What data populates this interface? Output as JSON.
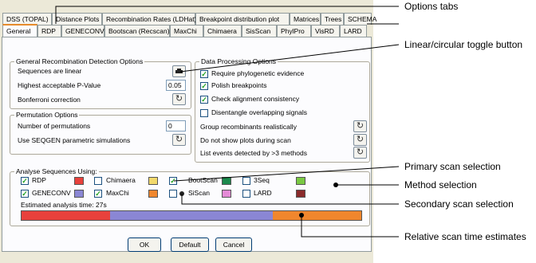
{
  "tabs_row1": [
    "DSS (TOPAL)",
    "Distance Plots",
    "Recombination Rates (LDHat)",
    "Breakpoint distribution plot",
    "Matrices",
    "Trees",
    "SCHEMA"
  ],
  "tabs_row2": [
    "General",
    "RDP",
    "GENECONV",
    "Bootscan (Recscan)",
    "MaxChi",
    "Chimaera",
    "SisScan",
    "PhylPro",
    "VisRD",
    "LARD"
  ],
  "active_tab": "General",
  "general_detection": {
    "title": "General Recombination Detection Options",
    "sequences_label": "Sequences are linear",
    "pvalue_label": "Highest acceptable P-Value",
    "pvalue": "0.05",
    "bonferroni_label": "Bonferroni correction"
  },
  "permutation": {
    "title": "Permutation Options",
    "num_label": "Number of permutations",
    "num_value": "0",
    "seqgen_label": "Use SEQGEN parametric simulations"
  },
  "data_processing": {
    "title": "Data Processing Options",
    "items": [
      {
        "label": "Require phylogenetic evidence",
        "checked": true
      },
      {
        "label": "Polish breakpoints",
        "checked": true
      },
      {
        "label": "Check alignment consistency",
        "checked": true
      },
      {
        "label": "Disentangle overlapping signals",
        "checked": false
      }
    ],
    "group_label": "Group recombinants realistically",
    "plots_label": "Do not show plots during scan",
    "list_label": "List events detected by >3 methods"
  },
  "analyse": {
    "title": "Analyse Sequences Using:",
    "methods": [
      {
        "name": "RDP",
        "checked": true,
        "color": "#e8413c"
      },
      {
        "name": "Chimaera",
        "checked": false,
        "color": "#f2d96a"
      },
      {
        "name": "BootScan",
        "checked": true,
        "color": "#1b8a4c"
      },
      {
        "name": "3Seq",
        "checked": false,
        "color": "#7ac943"
      },
      {
        "name": "GENECONV",
        "checked": true,
        "color": "#8a86d4"
      },
      {
        "name": "MaxChi",
        "checked": true,
        "color": "#f0862d"
      },
      {
        "name": "SiScan",
        "checked": false,
        "color": "#e58ad6"
      },
      {
        "name": "LARD",
        "checked": false,
        "color": "#8a2b2b"
      }
    ],
    "estimate_label": "Estimated analysis time: 27s",
    "time_bar": [
      {
        "method": "RDP",
        "fraction": 0.26,
        "color": "#e8413c"
      },
      {
        "method": "GENECONV",
        "fraction": 0.48,
        "color": "#8a86d4"
      },
      {
        "method": "MaxChi",
        "fraction": 0.26,
        "color": "#f0862d"
      }
    ]
  },
  "buttons": {
    "ok": "OK",
    "default": "Default",
    "cancel": "Cancel"
  },
  "annotations": {
    "options_tabs": "Options tabs",
    "toggle": "Linear/circular toggle button",
    "primary": "Primary scan selection",
    "method": "Method selection",
    "secondary": "Secondary scan selection",
    "relative": "Relative scan time estimates"
  }
}
